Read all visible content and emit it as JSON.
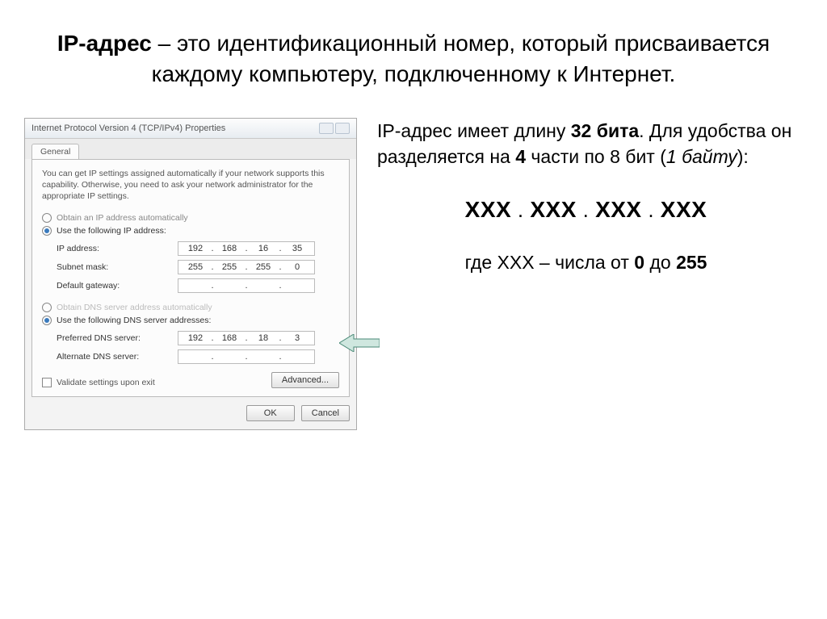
{
  "title": {
    "term": "IP-адрес",
    "rest": " – это идентификационный номер, который присваивается каждому компьютеру, подключенному к Интернет."
  },
  "dialog": {
    "window_title": "Internet Protocol Version 4 (TCP/IPv4) Properties",
    "tab": "General",
    "note": "You can get IP settings assigned automatically if your network supports this capability. Otherwise, you need to ask your network administrator for the appropriate IP settings.",
    "radio_auto_ip": "Obtain an IP address automatically",
    "radio_use_ip": "Use the following IP address:",
    "ip_label": "IP address:",
    "ip_val": [
      "192",
      "168",
      "16",
      "35"
    ],
    "subnet_label": "Subnet mask:",
    "subnet_val": [
      "255",
      "255",
      "255",
      "0"
    ],
    "gw_label": "Default gateway:",
    "gw_val": [
      "",
      "",
      "",
      ""
    ],
    "radio_auto_dns": "Obtain DNS server address automatically",
    "radio_use_dns": "Use the following DNS server addresses:",
    "pdns_label": "Preferred DNS server:",
    "pdns_val": [
      "192",
      "168",
      "18",
      "3"
    ],
    "adns_label": "Alternate DNS server:",
    "adns_val": [
      "",
      "",
      "",
      ""
    ],
    "validate": "Validate settings upon exit",
    "advanced_btn": "Advanced...",
    "ok_btn": "OK",
    "cancel_btn": "Cancel"
  },
  "right": {
    "p1a": "IP-адрес имеет длину ",
    "p1b": "32 бита",
    "p1c": ". Для удобства он разделяется на ",
    "p1d": "4",
    "p1e": " части по 8 бит (",
    "p1f": "1 байту",
    "p1g": "):",
    "pattern_x": "ХХХ",
    "pattern_dot": " . ",
    "where_a": "где ХХХ – числа от ",
    "where_b": "0",
    "where_c": " до ",
    "where_d": "255"
  }
}
